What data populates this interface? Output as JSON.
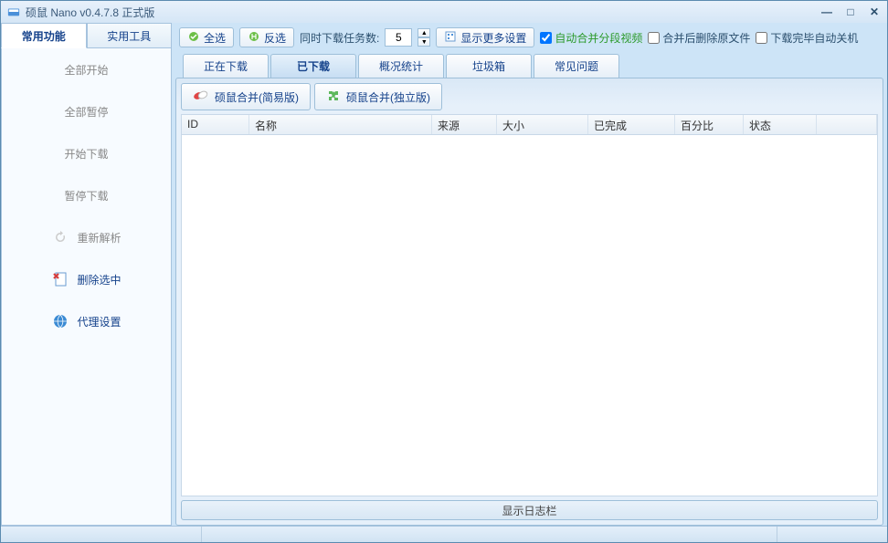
{
  "title": "硕鼠 Nano v0.4.7.8 正式版",
  "leftTabs": {
    "active": "常用功能",
    "inactive": "实用工具"
  },
  "sideButtons": {
    "startAll": "全部开始",
    "pauseAll": "全部暂停",
    "startDl": "开始下载",
    "pauseDl": "暂停下载",
    "reparse": "重新解析",
    "delSel": "删除选中",
    "proxy": "代理设置"
  },
  "toolbar": {
    "selectAll": "全选",
    "invert": "反选",
    "concurrentLabel": "同时下载任务数:",
    "concurrentValue": "5",
    "moreSettings": "显示更多设置",
    "chkAutoMerge": "自动合并分段视频",
    "chkDelAfter": "合并后删除原文件",
    "chkShutdown": "下载完毕自动关机"
  },
  "contentTabs": {
    "downloading": "正在下载",
    "downloaded": "已下载",
    "stats": "概况统计",
    "trash": "垃圾箱",
    "faq": "常见问题"
  },
  "mergeBtns": {
    "simple": "硕鼠合并(简易版)",
    "standalone": "硕鼠合并(独立版)"
  },
  "tableHeaders": {
    "id": "ID",
    "name": "名称",
    "src": "来源",
    "size": "大小",
    "done": "已完成",
    "pct": "百分比",
    "status": "状态"
  },
  "logbar": "显示日志栏"
}
